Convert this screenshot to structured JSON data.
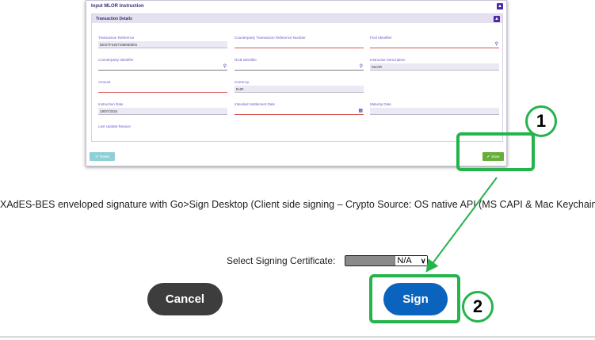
{
  "form": {
    "title": "Input MLOR Instruction",
    "section_title": "Transaction Details",
    "fields": [
      {
        "label": "Transaction Reference",
        "value": "DESTF2407196000001",
        "style": "filled"
      },
      {
        "label": "Counterparty Transaction Reference Number",
        "value": "",
        "style": "required"
      },
      {
        "label": "Pool Identifier",
        "value": "",
        "style": "required",
        "lookup": true
      },
      {
        "label": "Counterparty Identifier",
        "value": "",
        "style": "plain",
        "lookup": true
      },
      {
        "label": "NCB Identifier",
        "value": "",
        "style": "plain",
        "lookup": true
      },
      {
        "label": "Instruction Description",
        "value": "MLOR",
        "style": "filled"
      },
      {
        "label": "Amount",
        "value": "",
        "style": "required"
      },
      {
        "label": "Currency",
        "value": "EUR",
        "style": "filled"
      },
      {
        "label": "Instruction Date",
        "value": "19/07/2024",
        "style": "filled"
      },
      {
        "label": "Intended Settlement Date",
        "value": "",
        "style": "required",
        "calendar": true
      },
      {
        "label": "Maturity Date",
        "value": "",
        "style": "filled"
      },
      {
        "label": "Last Update Reason",
        "value": "",
        "style": "plain"
      }
    ],
    "reset_label": "Reset",
    "save_label": "Save"
  },
  "signature_description": "XAdES-BES enveloped signature with Go>Sign Desktop (Client side signing – Crypto Source: OS native API (MS CAPI & Mac Keychain))",
  "certificate": {
    "label": "Select Signing Certificate:",
    "selected": "N/A"
  },
  "buttons": {
    "cancel": "Cancel",
    "sign": "Sign"
  },
  "annotations": {
    "step1": "1",
    "step2": "2",
    "highlight_color": "#25b34b"
  },
  "colors": {
    "form_accent": "#4b2aa3",
    "sign_button": "#0a63bd",
    "cancel_button": "#3d3d3d",
    "save_button": "#66b03a",
    "reset_button": "#8fd0d8"
  }
}
